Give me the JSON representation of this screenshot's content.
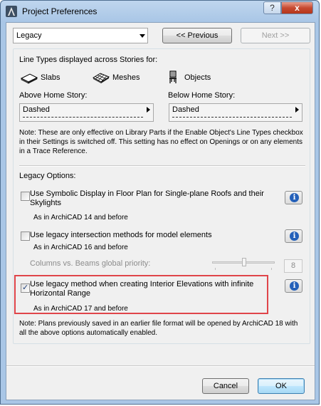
{
  "window": {
    "title": "Project Preferences",
    "help_label": "?",
    "close_label": "x"
  },
  "nav": {
    "category": "Legacy",
    "previous_label": "<< Previous",
    "next_label": "Next >>"
  },
  "linetypes": {
    "heading": "Line Types displayed across Stories for:",
    "slabs_label": "Slabs",
    "meshes_label": "Meshes",
    "objects_label": "Objects",
    "above_label": "Above Home Story:",
    "below_label": "Below Home Story:",
    "above_value": "Dashed",
    "below_value": "Dashed",
    "note": "Note: These are only effective on Library Parts if the Enable Object's Line Types checkbox in their Settings is switched off. This setting has no effect on Openings or on any elements in a Trace Reference."
  },
  "legacy": {
    "heading": "Legacy Options:",
    "opt1_label": "Use Symbolic Display in Floor Plan for Single-plane Roofs and their Skylights",
    "opt1_note": "As in ArchiCAD 14 and before",
    "opt1_checked": false,
    "opt2_label": "Use legacy intersection methods for model elements",
    "opt2_note": "As in ArchiCAD 16 and before",
    "opt2_checked": false,
    "priority_label": "Columns vs. Beams global priority:",
    "priority_value": "8",
    "opt3_label": "Use legacy method when creating Interior Elevations with infinite Horizontal Range",
    "opt3_note": "As in ArchiCAD 17 and before",
    "opt3_checked": true,
    "highlight_color": "#e0454a",
    "bottom_note": "Note: Plans previously saved in an earlier file format will be opened by ArchiCAD 18 with all the above options automatically enabled."
  },
  "footer": {
    "cancel_label": "Cancel",
    "ok_label": "OK"
  },
  "icons": {
    "info": "i",
    "checkmark": "✓"
  }
}
